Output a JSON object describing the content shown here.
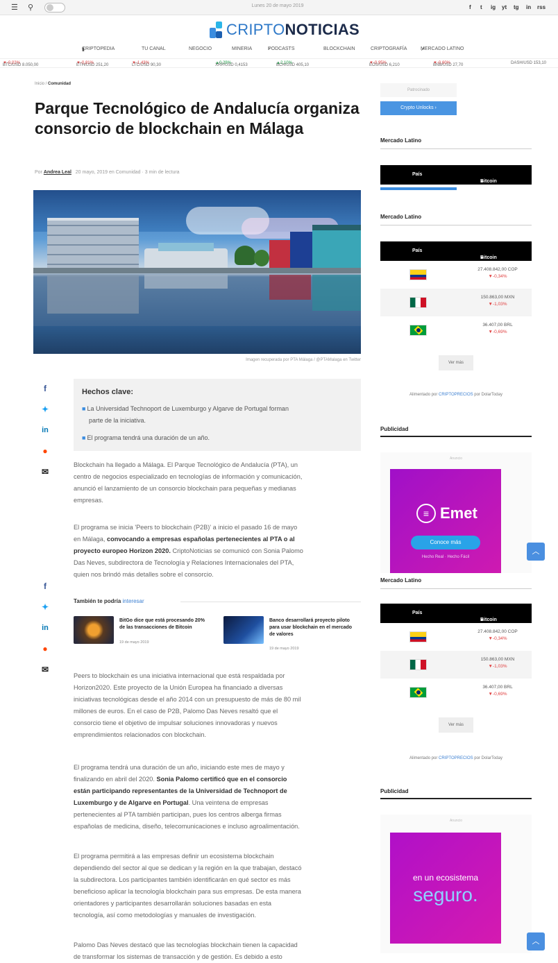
{
  "topbar": {
    "date": "Lunes 20 de mayo 2019",
    "social": [
      "f",
      "t",
      "ig",
      "yt",
      "tg",
      "in",
      "rss"
    ]
  },
  "logo": {
    "light": "CRIPTO",
    "bold": "NOTICIAS"
  },
  "nav": [
    {
      "label": "CRIPTOPEDIA",
      "icon": "book-icon",
      "icon_char": "▮"
    },
    {
      "label": "TU CANAL"
    },
    {
      "label": "NEGOCIO"
    },
    {
      "label": "MINERIA"
    },
    {
      "label": "PODCASTS",
      "icon": "microphone-icon",
      "icon_char": "♪"
    },
    {
      "label": "BLOCKCHAIN"
    },
    {
      "label": "CRIPTOGRAFÍA"
    },
    {
      "label": "MERCADO LATINO",
      "icon": "chart-icon",
      "icon_char": "↗"
    }
  ],
  "ticker": [
    {
      "text": "BTC/USD 8.050,00",
      "change": "▼-0,02%",
      "dir": "down"
    },
    {
      "text": "ETH/USD 251,20",
      "change": "▼-0,81%",
      "dir": "down"
    },
    {
      "text": "LTC/USD 90,30",
      "change": "▼-1,43%",
      "dir": "down"
    },
    {
      "text": "XRP/USD 0,4153",
      "change": "▲0,29%",
      "dir": "up"
    },
    {
      "text": "BCH/USD 405,10",
      "change": "▲2,10%",
      "dir": "up"
    },
    {
      "text": "EOS/USD 6,210",
      "change": "▼-0,95%",
      "dir": "down"
    },
    {
      "text": "BNB/USD 27,70",
      "change": "▼-0,60%",
      "dir": "down"
    },
    {
      "text": "DASH/USD 153,10",
      "change": "",
      "dir": "down"
    }
  ],
  "breadcrumb": {
    "home": "Inicio",
    "section": "Comunidad",
    "sep": " / "
  },
  "article": {
    "title": "Parque Tecnológico de Andalucía organiza consorcio de blockchain en Málaga",
    "by": "Por ",
    "author": "Andrea Leal",
    "meta": "20 mayo, 2019 en Comunidad · 3 min de lectura",
    "image_caption": "Imagen recuperada por PTA Málaga / @PTAMalaga en Twitter",
    "key_title": "Hechos clave:",
    "key_points": [
      "La Universidad Technoport de Luxemburgo y Algarve de Portugal forman",
      "parte de la iniciativa.",
      "El programa tendrá una duración de un año."
    ],
    "p1": [
      "Blockchain ha llegado a Málaga. El Parque Tecnológico de Andalucía (PTA), un",
      "centro de negocios especializado en tecnologías de información y comunicación,",
      "anunció el lanzamiento de un consorcio blockchain para pequeñas y medianas",
      "empresas."
    ],
    "p2": [
      "El programa se inicia 'Peers to blockchain (P2B)' a inicio el pasado 16 de mayo",
      "en Málaga, ",
      "convocando a empresas españolas pertenecientes al PTA o al",
      "proyecto europeo Horizon 2020. ",
      "CriptoNoticias se comunicó con Sonia Palomo",
      "Das Neves, subdirectora de Tecnología y Relaciones Internacionales del PTA,",
      "quien nos brindó más detalles sobre el consorcio."
    ],
    "also_label": "También te podría ",
    "also_link": "interesar",
    "related": [
      {
        "title": "BitGo dice que está procesando 20% de las transacciones de Bitcoin",
        "date": "19 de mayo 2019"
      },
      {
        "title": "Banco desarrollará proyecto piloto para usar blockchain en el mercado de valores",
        "date": "19 de mayo 2019"
      }
    ],
    "p3": [
      "Peers to blockchain es una iniciativa internacional que está respaldada por",
      "Horizon2020. Este proyecto de la Unión Europea ha financiado a diversas",
      "iniciativas tecnológicas desde el año 2014 con un presupuesto de más de 80 mil",
      "millones de euros. En el caso de P2B, Palomo Das Neves resaltó que el",
      "consorcio tiene el objetivo de impulsar soluciones innovadoras y nuevos",
      "emprendimientos relacionados con blockchain."
    ],
    "p4": [
      "El programa tendrá una duración de un año, iniciando este mes de mayo y",
      "finalizando en abril del 2020. ",
      "Sonia Palomo certificó que en el consorcio",
      "están participando representantes de la Universidad de Technoport de",
      "Luxemburgo y de Algarve en Portugal",
      ". Una veintena de empresas",
      "pertenecientes al PTA también participan, pues los centros alberga firmas",
      "españolas de medicina, diseño, telecomunicaciones e incluso agroalimentación."
    ],
    "p5": [
      "El programa permitirá a las empresas definir un ecosistema blockchain",
      "dependiendo del sector al que se dedican y la región en la que trabajan, destacó",
      "la subdirectora. Los participantes también identificarán en qué sector es más",
      "beneficioso aplicar la tecnología blockchain para sus empresas. De esta manera",
      "orientadores y participantes desarrollarán soluciones basadas en esta",
      "tecnología, así como metodologías y manuales de investigación."
    ],
    "p6": [
      "Palomo Das Neves destacó que las tecnologías blockchain tienen la capacidad",
      "de transformar los sistemas de transacción y de gestión. Es debido a esto"
    ]
  },
  "sidebar": {
    "ad_small_label": "Patrocinado",
    "cta_button": "Crypto Unlocks ›",
    "market_title": "Mercado Latino",
    "tab_pais": "País",
    "tab_bitcoin": "Bitcoin",
    "rows": [
      {
        "country": "Colombia",
        "value": "27.408.842,00 COP",
        "change": "▼-0,34%",
        "c": [
          "#fcd116",
          "#003893",
          "#ce1126"
        ]
      },
      {
        "country": "México",
        "value": "150.863,00 MXN",
        "change": "▼-1,03%",
        "c": [
          "#006847",
          "#ffffff",
          "#ce1126"
        ]
      },
      {
        "country": "Brasil",
        "value": "36.407,00 BRL",
        "change": "▼-0,69%",
        "c": [
          "#009c3b",
          "#ffdf00",
          "#002776"
        ]
      }
    ],
    "more_button": "Ver más",
    "note": "Alimentado por ",
    "note_link": "CRIPTOPRECIOS",
    "note_end": " por DolarToday",
    "ad_title": "Publicidad",
    "ad_label": "Anuncio",
    "emet_name": "Emet",
    "emet_btn": "Conoce más",
    "emet_sub": "Hecho Real · Hecho Fácil",
    "ad2_line1": "en un ecosistema",
    "ad2_line2": "seguro.",
    "rows2": [
      {
        "value": "27.408.842,00 COP",
        "change": "▼-0,34%"
      },
      {
        "value": "150.863,00 MXN",
        "change": "▼-1,03%"
      },
      {
        "value": "36.407,00 BRL",
        "change": "▼-0,69%"
      }
    ]
  },
  "colors": {
    "accent": "#3b8de0",
    "brand_dark": "#1c2b4a",
    "ad_purple": "#b40fc7",
    "down": "#e04040",
    "up": "#21a04a"
  }
}
